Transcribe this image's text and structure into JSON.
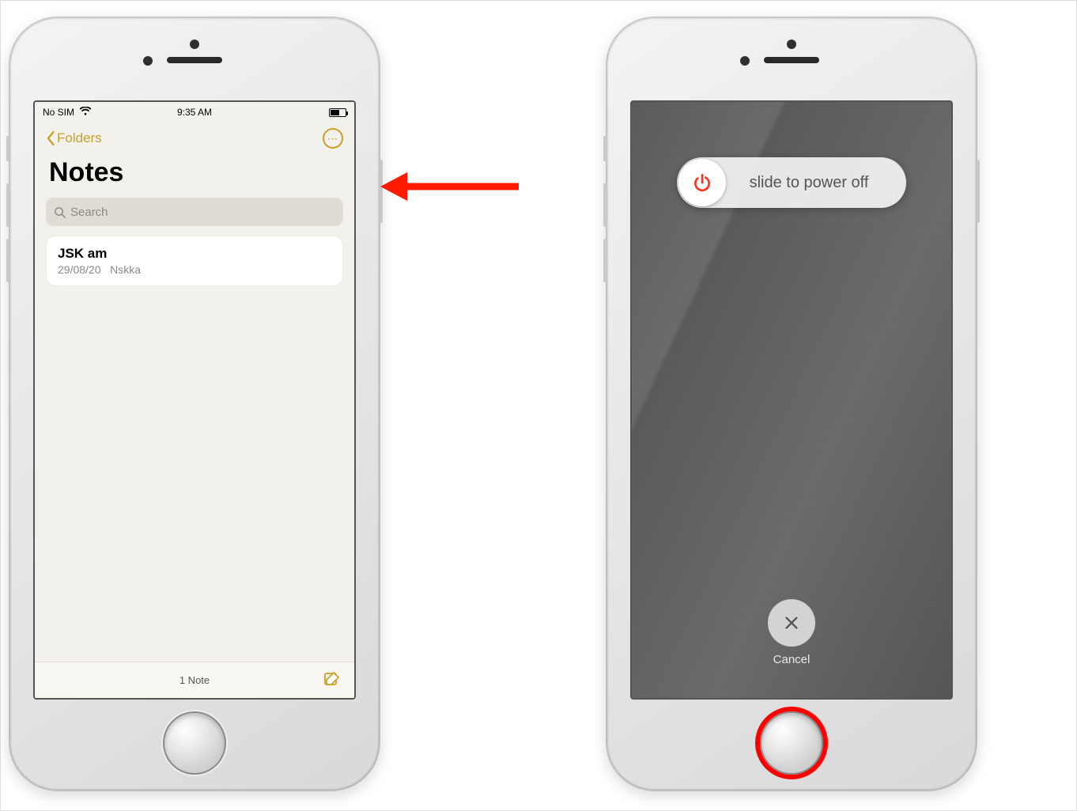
{
  "statusbar": {
    "carrier": "No SIM",
    "time": "9:35 AM"
  },
  "nav": {
    "back_label": "Folders"
  },
  "title": "Notes",
  "search": {
    "placeholder": "Search"
  },
  "notes": [
    {
      "title": "JSK am",
      "date": "29/08/20",
      "preview": "Nskka"
    }
  ],
  "toolbar": {
    "count_label": "1 Note"
  },
  "poweroff": {
    "slide_label": "slide to power off",
    "cancel_label": "Cancel"
  }
}
